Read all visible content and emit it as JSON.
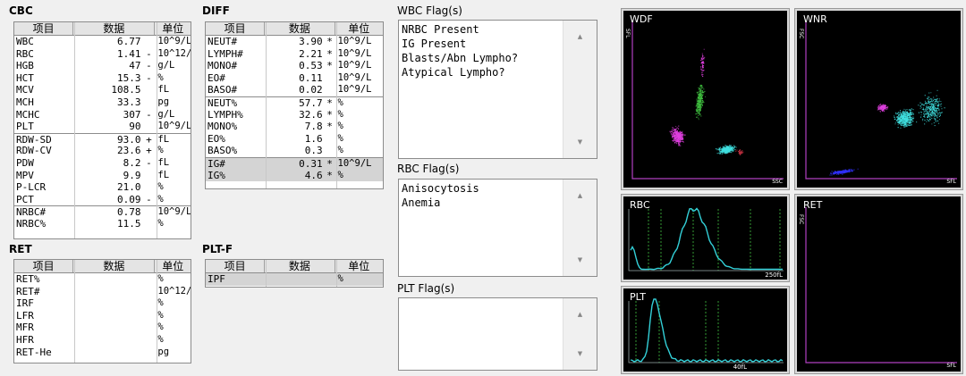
{
  "cbc": {
    "title": "CBC",
    "headers": [
      "项目",
      "数据",
      "单位"
    ],
    "rows": [
      {
        "item": "WBC",
        "value": "6.77",
        "flag": "",
        "unit": "10^9/L"
      },
      {
        "item": "RBC",
        "value": "1.41",
        "flag": "-",
        "unit": "10^12/L"
      },
      {
        "item": "HGB",
        "value": "47",
        "flag": "-",
        "unit": "g/L"
      },
      {
        "item": "HCT",
        "value": "15.3",
        "flag": "-",
        "unit": "%"
      },
      {
        "item": "MCV",
        "value": "108.5",
        "flag": "",
        "unit": "fL"
      },
      {
        "item": "MCH",
        "value": "33.3",
        "flag": "",
        "unit": "pg"
      },
      {
        "item": "MCHC",
        "value": "307",
        "flag": "-",
        "unit": "g/L"
      },
      {
        "item": "PLT",
        "value": "90",
        "flag": "",
        "unit": "10^9/L"
      },
      {
        "item": "RDW-SD",
        "value": "93.0",
        "flag": "+",
        "unit": "fL"
      },
      {
        "item": "RDW-CV",
        "value": "23.6",
        "flag": "+",
        "unit": "%"
      },
      {
        "item": "PDW",
        "value": "8.2",
        "flag": "-",
        "unit": "fL"
      },
      {
        "item": "MPV",
        "value": "9.9",
        "flag": "",
        "unit": "fL"
      },
      {
        "item": "P-LCR",
        "value": "21.0",
        "flag": "",
        "unit": "%"
      },
      {
        "item": "PCT",
        "value": "0.09",
        "flag": "-",
        "unit": "%"
      },
      {
        "item": "NRBC#",
        "value": "0.78",
        "flag": "",
        "unit": "10^9/L"
      },
      {
        "item": "NRBC%",
        "value": "11.5",
        "flag": "",
        "unit": "%"
      }
    ]
  },
  "diff": {
    "title": "DIFF",
    "headers": [
      "项目",
      "数据",
      "单位"
    ],
    "rows": [
      {
        "item": "NEUT#",
        "value": "3.90",
        "flag": "*",
        "unit": "10^9/L"
      },
      {
        "item": "LYMPH#",
        "value": "2.21",
        "flag": "*",
        "unit": "10^9/L"
      },
      {
        "item": "MONO#",
        "value": "0.53",
        "flag": "*",
        "unit": "10^9/L"
      },
      {
        "item": "EO#",
        "value": "0.11",
        "flag": "",
        "unit": "10^9/L"
      },
      {
        "item": "BASO#",
        "value": "0.02",
        "flag": "",
        "unit": "10^9/L"
      },
      {
        "item": "NEUT%",
        "value": "57.7",
        "flag": "*",
        "unit": "%"
      },
      {
        "item": "LYMPH%",
        "value": "32.6",
        "flag": "*",
        "unit": "%"
      },
      {
        "item": "MONO%",
        "value": "7.8",
        "flag": "*",
        "unit": "%"
      },
      {
        "item": "EO%",
        "value": "1.6",
        "flag": "",
        "unit": "%"
      },
      {
        "item": "BASO%",
        "value": "0.3",
        "flag": "",
        "unit": "%"
      },
      {
        "item": "IG#",
        "value": "0.31",
        "flag": "*",
        "unit": "10^9/L"
      },
      {
        "item": "IG%",
        "value": "4.6",
        "flag": "*",
        "unit": "%"
      }
    ]
  },
  "ret": {
    "title": "RET",
    "headers": [
      "项目",
      "数据",
      "单位"
    ],
    "rows": [
      {
        "item": "RET%",
        "value": "",
        "flag": "",
        "unit": "%"
      },
      {
        "item": "RET#",
        "value": "",
        "flag": "",
        "unit": "10^12/L"
      },
      {
        "item": "IRF",
        "value": "",
        "flag": "",
        "unit": "%"
      },
      {
        "item": "LFR",
        "value": "",
        "flag": "",
        "unit": "%"
      },
      {
        "item": "MFR",
        "value": "",
        "flag": "",
        "unit": "%"
      },
      {
        "item": "HFR",
        "value": "",
        "flag": "",
        "unit": "%"
      },
      {
        "item": "RET-He",
        "value": "",
        "flag": "",
        "unit": "pg"
      }
    ]
  },
  "pltf": {
    "title": "PLT-F",
    "headers": [
      "项目",
      "数据",
      "单位"
    ],
    "rows": [
      {
        "item": "IPF",
        "value": "",
        "flag": "",
        "unit": "%"
      }
    ]
  },
  "flags": {
    "wbc_title": "WBC Flag(s)",
    "wbc": [
      "NRBC Present",
      "IG Present",
      "Blasts/Abn Lympho?",
      "Atypical Lympho?"
    ],
    "rbc_title": "RBC Flag(s)",
    "rbc": [
      "Anisocytosis",
      "Anemia"
    ],
    "plt_title": "PLT Flag(s)",
    "plt": []
  },
  "plots": {
    "wdf": {
      "title": "WDF",
      "x_axis": "SSC",
      "y_axis": "SFL"
    },
    "wnr": {
      "title": "WNR",
      "x_axis": "SFL",
      "y_axis": "FSC"
    },
    "rbc": {
      "title": "RBC",
      "x_max": "250fL"
    },
    "plt": {
      "title": "PLT",
      "x_max": "40fL"
    },
    "ret": {
      "title": "RET",
      "x_axis": "SFL",
      "y_axis": "FSC"
    }
  },
  "colors": {
    "curve": "#33d0d8",
    "neut": "#40e0e0",
    "lymph": "#e040e0",
    "mono": "#40c040",
    "rbc_ghost": "#3030ff",
    "marker_line": "#40c040"
  }
}
